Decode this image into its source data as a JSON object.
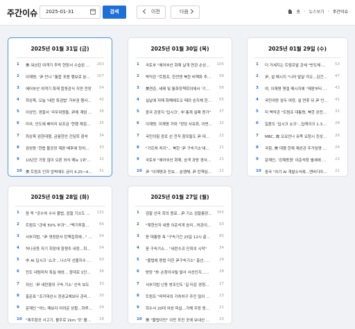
{
  "header": {
    "title": "주간이슈",
    "date_value": "2025-01-31",
    "search_label": "검색",
    "prev_label": "이전",
    "next_label": "다음",
    "breadcrumb": [
      "홈",
      "뉴스보기",
      "주간이슈"
    ]
  },
  "cards": [
    {
      "date_title": "2025년 01월 31일 (금)",
      "items": [
        {
          "title": "美 워싱턴 여객기 추락 현장서 수습된 시...",
          "count": "263"
        },
        {
          "title": "이재명, '尹 만나 \"통합 포용 행보로 분명...",
          "count": "107"
        },
        {
          "title": "에어부산 여객기 화재 합동감식 지연 전망",
          "count": "54"
        },
        {
          "title": "최상목, 오늘 '내란 특검법' 거부권 행사...",
          "count": "42"
        },
        {
          "title": "이상민, 경찰서 '국무위원들, 尹에 계엄 ...",
          "count": "36"
        },
        {
          "title": "미국, 인도에 베터리 보조금 '현행 재검토...",
          "count": "35"
        },
        {
          "title": "최상목 권한대행, 금융현안 간담회 참석",
          "count": "34"
        },
        {
          "title": "권성동 '헌법 불공정 재판 배후에 정치...",
          "count": "33"
        },
        {
          "title": "10년간 가장 많이 오른 외식 메뉴 1위'...",
          "count": "32"
        },
        {
          "title": "美 트럼프 인하 압박에도 금리 4.25~4.5...",
          "count": "31"
        }
      ]
    },
    {
      "date_title": "2025년 01월 30일 (목)",
      "items": [
        {
          "title": "국토부 \"에어부산 화재 날개 연관 손상...",
          "count": "105"
        },
        {
          "title": "박덕관 \"트럼프, 한전엔 북한 비핵화 추...",
          "count": "58"
        },
        {
          "title": "美연준, 세제 및 통화정책회의에서 '기준...",
          "count": "56"
        },
        {
          "title": "실낱에 저매 화폐에도오 때려 승지체 한...",
          "count": "55"
        },
        {
          "title": "중국 관광지 '딥시크', 中 통계 실패 증가\"",
          "count": "37"
        },
        {
          "title": "이재명, 이재명 거대 \"정당 사유화, 이번...",
          "count": "32"
        },
        {
          "title": "국민의힘 광로 선 전직 참모들도 尹 대통...",
          "count": "22"
        },
        {
          "title": "\"가르쳐 처지\"... 북한 '尹 구속기소'내를...",
          "count": "21"
        },
        {
          "title": "국토부 \"에어부산 화재, 승객 과방 경사...",
          "count": "21"
        },
        {
          "title": "尹 \"이재명과 진보... 분쟁해, 尹 탄핵심...",
          "count": "21"
        }
      ]
    },
    {
      "date_title": "2025년 01월 29일 (수)",
      "items": [
        {
          "title": "더 거세지는 트럼프발 관세 \"반도체·철...",
          "count": "53"
        },
        {
          "title": "尹, 설 메시지 \"나라 발달 각오...김건희...",
          "count": "47"
        },
        {
          "title": "여, 이재명 명절 메시지에 \"재판부터 받...",
          "count": "43"
        },
        {
          "title": "국민여랑 앞두 여정, 설 연휴 뒤 尹 언...",
          "count": "41"
        },
        {
          "title": "미 백악관 \"트럼프 대통령, 북한 완전한...",
          "count": "31"
        },
        {
          "title": "일론도 '딥시크 쇼크'...딥케이크 1.39...",
          "count": "28"
        },
        {
          "title": "MBC, 故 오요안나 유족 요청시 진상조...",
          "count": "26"
        },
        {
          "title": "국힘, 美 대행 한제 제완관 주거임명 \"이...",
          "count": "24"
        },
        {
          "title": "문재인, '강제동원' 이준석창 별세에 추모",
          "count": "22"
        },
        {
          "title": "중국 \"차기 AI 개발소식에...엔비디아 주...",
          "count": "21"
        }
      ]
    },
    {
      "date_title": "2025년 01월 28일 (화)",
      "items": [
        {
          "title": "윤 즉 \"공수처 수사 불법, 검찰 기소도 불...",
          "count": "131"
        },
        {
          "title": "트럼프 \"관세 50% 부과\"...\"백기투항한 ...",
          "count": "66"
        },
        {
          "title": "서부지법, \"尹 영장판사 탄핵집회에...\" 주...",
          "count": "54"
        },
        {
          "title": "허나공등 자기 회장에 항쟁주 내정...회...",
          "count": "54"
        },
        {
          "title": "中 AI 딥시크 '쇼크'...나스닥 선물지수 3...",
          "count": "50"
        },
        {
          "title": "진도 내림마치 특실 헤성... 중대로 1단계...",
          "count": "36"
        },
        {
          "title": "외신, '尹 내란혐의 구속 기소' 신속 보도",
          "count": "33"
        },
        {
          "title": "홍준표 \"조기대선시 정권교체보다 관리...",
          "count": "30"
        },
        {
          "title": "문재인 \"어느 때보다 어려운 상황...하루...",
          "count": "29"
        },
        {
          "title": "\"제주항공 사고기, 활주로 2km '모' 활주...",
          "count": "28"
        }
      ]
    },
    {
      "date_title": "2025년 01월 27일 (월)",
      "items": [
        {
          "title": "검찰 선국 회의 종료...尹 기소 검찰총장...",
          "count": "355"
        },
        {
          "title": "\"재현신자 내용 이준석게 승리...허관이...",
          "count": "93"
        },
        {
          "title": "윤 대통령 측 \"구속기간 25일 12시 끝...",
          "count": "85"
        },
        {
          "title": "윤 구속기소... \"내란수괴 단죄의 시작\"",
          "count": "34"
        },
        {
          "title": "\"불법에 편법 더한 尹구속기소\" 홍선, 안...",
          "count": "29"
        },
        {
          "title": "방망 \"外 손창아샤릴 발사 사선인지...내...",
          "count": "28"
        },
        {
          "title": "서부지법 난동 방조인도 '길 타운 경청...",
          "count": "27"
        },
        {
          "title": "트럼프 \"마약국의 가치차구 주인 많이 반...",
          "count": "23"
        },
        {
          "title": "회수서 20대 여성 피살...가해 주장 동거...",
          "count": "21"
        },
        {
          "title": "美 \"불법이민\" 이민 포진 곳에 보내선 안돼\"",
          "count": "20"
        }
      ]
    }
  ]
}
